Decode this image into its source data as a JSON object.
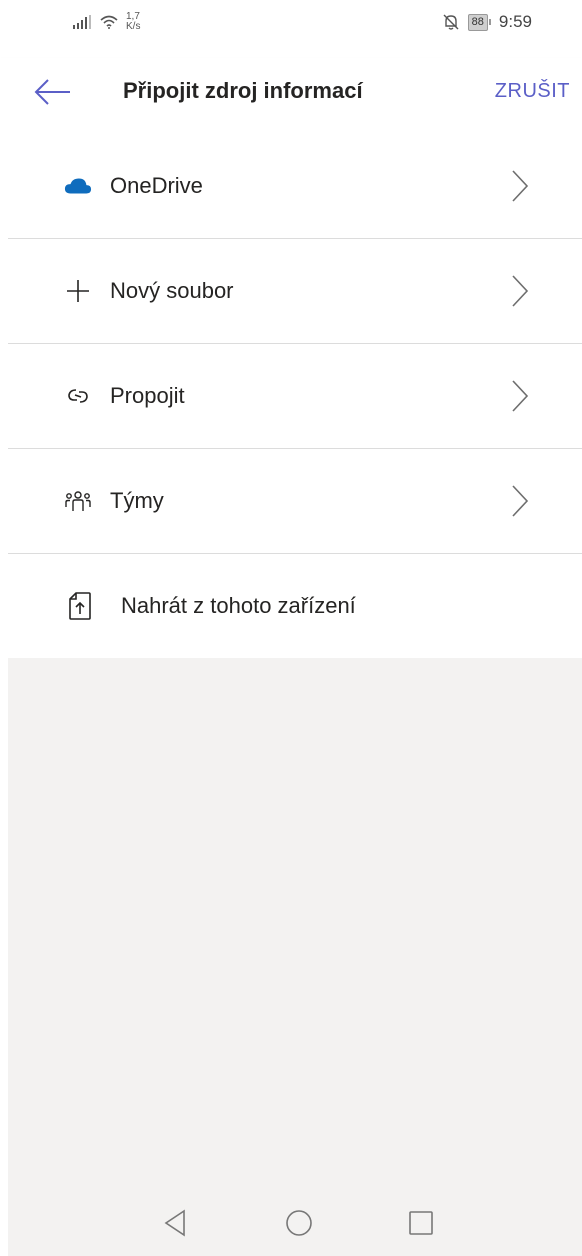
{
  "status_bar": {
    "net_speed_value": "1,7",
    "net_speed_unit": "K/s",
    "battery": "88",
    "time": "9:59"
  },
  "header": {
    "title": "Připojit zdroj informací",
    "cancel_label": "ZRUŠIT"
  },
  "menu": {
    "items": [
      {
        "label": "OneDrive",
        "icon": "onedrive-cloud-icon",
        "has_chevron": true
      },
      {
        "label": "Nový soubor",
        "icon": "plus-icon",
        "has_chevron": true
      },
      {
        "label": "Propojit",
        "icon": "link-icon",
        "has_chevron": true
      },
      {
        "label": "Týmy",
        "icon": "teams-people-icon",
        "has_chevron": true
      },
      {
        "label": "Nahrát z tohoto zařízení",
        "icon": "upload-file-icon",
        "has_chevron": false
      }
    ]
  },
  "colors": {
    "accent": "#5b5fc7",
    "onedrive": "#0f6cbd",
    "empty_area": "#f3f2f1",
    "divider": "#dcdcdc"
  },
  "nav_bar": {
    "icons": [
      "nav-back-icon",
      "nav-home-icon",
      "nav-recent-icon"
    ]
  }
}
